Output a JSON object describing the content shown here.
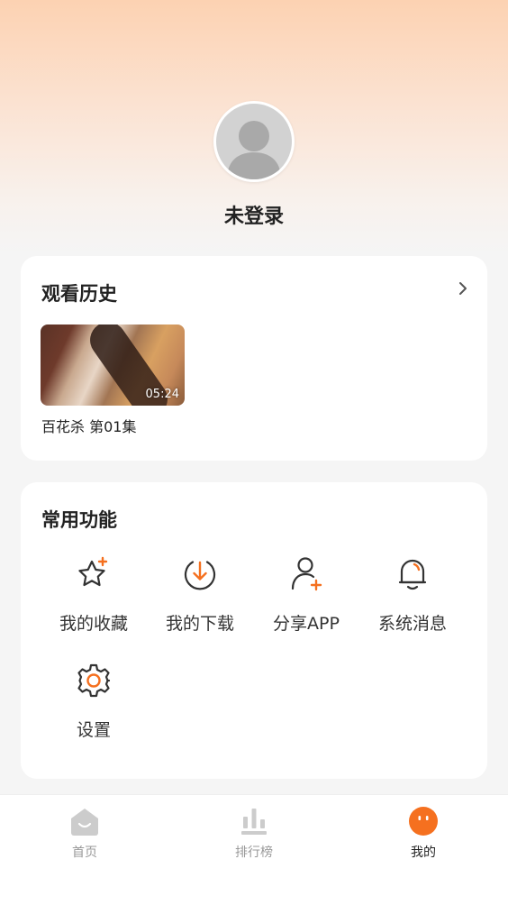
{
  "profile": {
    "username": "未登录"
  },
  "history": {
    "title": "观看历史",
    "items": [
      {
        "duration": "05:24",
        "title": "百花杀 第01集"
      }
    ]
  },
  "features": {
    "title": "常用功能",
    "items": [
      {
        "label": "我的收藏",
        "icon": "star-plus-icon"
      },
      {
        "label": "我的下载",
        "icon": "download-icon"
      },
      {
        "label": "分享APP",
        "icon": "share-user-icon"
      },
      {
        "label": "系统消息",
        "icon": "bell-icon"
      },
      {
        "label": "设置",
        "icon": "gear-icon"
      }
    ]
  },
  "tabbar": {
    "items": [
      {
        "label": "首页",
        "icon": "home-icon",
        "active": false
      },
      {
        "label": "排行榜",
        "icon": "ranking-icon",
        "active": false
      },
      {
        "label": "我的",
        "icon": "profile-face-icon",
        "active": true
      }
    ]
  },
  "colors": {
    "accent": "#f5701f",
    "icon_dark": "#333333",
    "inactive": "#cccccc"
  }
}
